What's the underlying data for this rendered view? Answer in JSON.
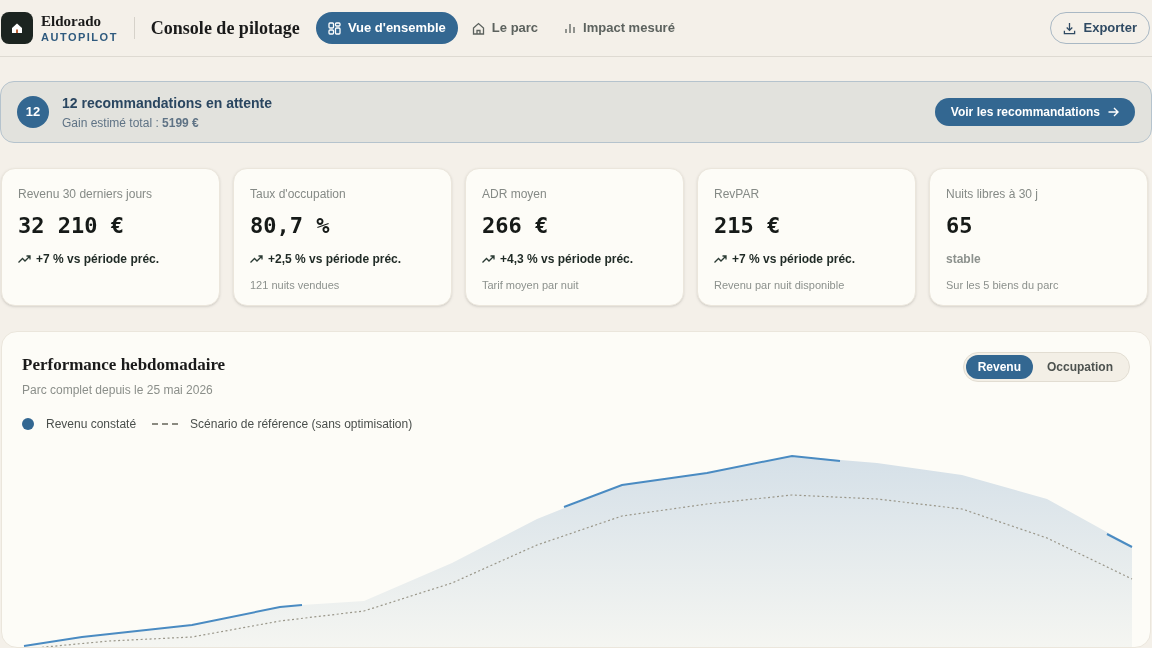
{
  "brand": {
    "name": "Eldorado",
    "tagline": "AUTOPILOT"
  },
  "page_title": "Console de pilotage",
  "nav": [
    {
      "label": "Vue d'ensemble",
      "kind": "grid",
      "selected": true
    },
    {
      "label": "Le parc",
      "kind": "house",
      "selected": false
    },
    {
      "label": "Impact mesuré",
      "kind": "bars",
      "selected": false
    }
  ],
  "export_button": "Exporter",
  "banner": {
    "count": "12",
    "title": "12 recommandations en attente",
    "subtitle": "Gain estimé total : **5199 €**",
    "button": "Voir les recommandations"
  },
  "kpis": [
    {
      "label": "Revenu 30 derniers jours",
      "value": "32 210 €",
      "trend": "+7 % vs période préc.",
      "kind": "up"
    },
    {
      "label": "Taux d'occupation",
      "value": "80,7 %",
      "trend": "+2,5 % vs période préc.",
      "kind": "up",
      "note": "121 nuits vendues"
    },
    {
      "label": "ADR moyen",
      "value": "266 €",
      "trend": "+4,3 % vs période préc.",
      "kind": "up",
      "note": "Tarif moyen par nuit"
    },
    {
      "label": "RevPAR",
      "value": "215 €",
      "trend": "+7 % vs période préc.",
      "kind": "up",
      "note": "Revenu par nuit disponible"
    },
    {
      "label": "Nuits libres à 30 j",
      "value": "65",
      "trend": "stable",
      "kind": "flat",
      "note": "Sur les 5 biens du parc"
    }
  ],
  "chart": {
    "title": "Performance hebdomadaire",
    "subtitle": "Parc complet depuis le 25 mai 2026",
    "toggle": [
      {
        "label": "Revenu",
        "selected": true
      },
      {
        "label": "Occupation",
        "selected": false
      }
    ],
    "legend": [
      {
        "label": "Revenu constaté",
        "kind": "dot",
        "color": "#336791"
      },
      {
        "label": "Scénario de référence (sans optimisation)",
        "kind": "dash",
        "color": "#8a8a80"
      }
    ]
  }
}
